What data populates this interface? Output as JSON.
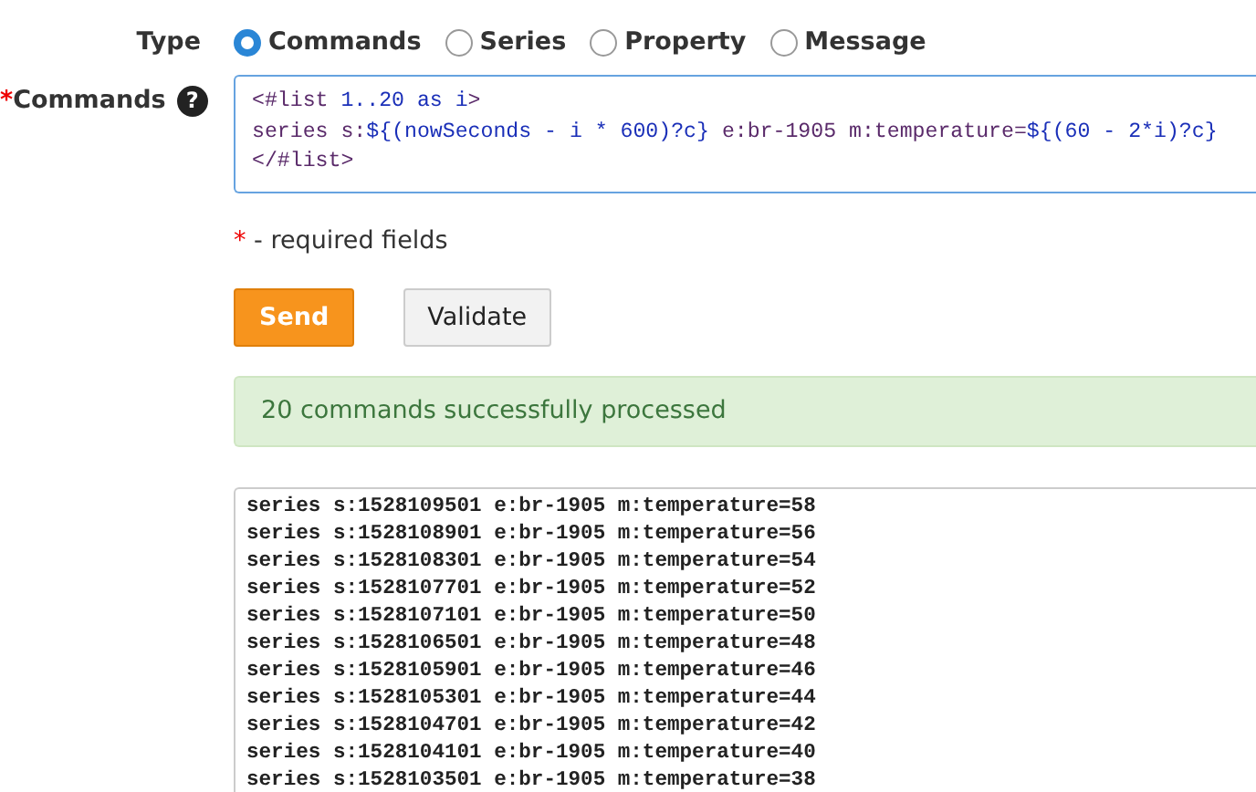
{
  "type_field": {
    "label": "Type",
    "options": [
      {
        "label": "Commands",
        "selected": true
      },
      {
        "label": "Series",
        "selected": false
      },
      {
        "label": "Property",
        "selected": false
      },
      {
        "label": "Message",
        "selected": false
      }
    ]
  },
  "commands_field": {
    "required_mark": "*",
    "label": "Commands",
    "help_icon": "?",
    "lines": [
      [
        {
          "text": "<#list",
          "kind": "tag"
        },
        {
          "text": " 1..20 as i",
          "kind": "expr"
        },
        {
          "text": ">",
          "kind": "tag"
        }
      ],
      [
        {
          "text": "series s:",
          "kind": "plain"
        },
        {
          "text": "${(nowSeconds - i * 600)?c}",
          "kind": "expr"
        },
        {
          "text": " e:br-1905 m:temperature=",
          "kind": "plain"
        },
        {
          "text": "${(60 - 2*i)?c}",
          "kind": "expr"
        }
      ],
      [
        {
          "text": "</#list>",
          "kind": "tag"
        }
      ]
    ]
  },
  "required_note": {
    "mark": "*",
    "text": "- required fields"
  },
  "buttons": [
    {
      "label": "Send",
      "kind": "primary"
    },
    {
      "label": "Validate",
      "kind": "secondary"
    }
  ],
  "alert": "20 commands successfully processed",
  "output_lines": [
    "series s:1528109501 e:br-1905 m:temperature=58",
    "series s:1528108901 e:br-1905 m:temperature=56",
    "series s:1528108301 e:br-1905 m:temperature=54",
    "series s:1528107701 e:br-1905 m:temperature=52",
    "series s:1528107101 e:br-1905 m:temperature=50",
    "series s:1528106501 e:br-1905 m:temperature=48",
    "series s:1528105901 e:br-1905 m:temperature=46",
    "series s:1528105301 e:br-1905 m:temperature=44",
    "series s:1528104701 e:br-1905 m:temperature=42",
    "series s:1528104101 e:br-1905 m:temperature=40",
    "series s:1528103501 e:br-1905 m:temperature=38"
  ]
}
